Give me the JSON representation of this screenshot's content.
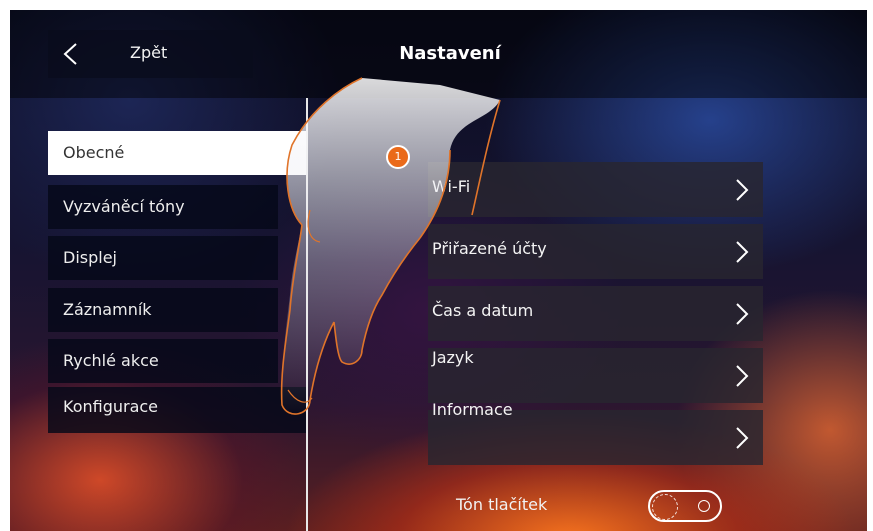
{
  "header": {
    "back_label": "Zpět",
    "title": "Nastavení"
  },
  "sidebar": {
    "items": [
      {
        "label": "Obecné",
        "active": true
      },
      {
        "label": "Vyzváněcí tóny"
      },
      {
        "label": "Displej"
      },
      {
        "label": "Záznamník"
      },
      {
        "label": "Rychlé akce"
      },
      {
        "label": "Konfigurace"
      }
    ]
  },
  "settings": {
    "items": [
      {
        "label": "Wi-Fi"
      },
      {
        "label": "Přiřazené účty"
      },
      {
        "label": "Čas a datum"
      },
      {
        "label": "Jazyk"
      },
      {
        "label": "Informace"
      }
    ]
  },
  "step_badge": "1",
  "key_tone": {
    "label": "Tón tlačítek",
    "enabled": false
  },
  "colors": {
    "accent": "#ea6a1a",
    "panel": "#050818",
    "active_item": "#ffffff"
  },
  "icons": {
    "back": "chevron-left-icon",
    "row": "chevron-right-icon"
  }
}
